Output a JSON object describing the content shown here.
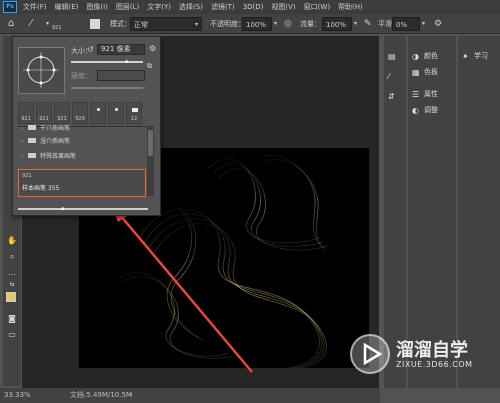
{
  "menu": [
    "文件(F)",
    "编辑(E)",
    "图像(I)",
    "图层(L)",
    "文字(Y)",
    "选择(S)",
    "滤镜(T)",
    "3D(D)",
    "视图(V)",
    "窗口(W)",
    "帮助(H)"
  ],
  "options": {
    "brush_size": "921",
    "mode_label": "模式：",
    "mode_value": "正常",
    "opacity_label": "不透明度：",
    "opacity_value": "100%",
    "flow_label": "流量：",
    "flow_value": "100%",
    "smoothing_label": "平滑：",
    "smoothing_value": "0%"
  },
  "brush_popup": {
    "size_label": "大小：",
    "size_value": "921 像素",
    "hardness_label": "硬度：",
    "presets": [
      "921",
      "921",
      "921",
      "929",
      "",
      "",
      "12"
    ],
    "folders": [
      {
        "label": "干介质画笔"
      },
      {
        "label": "湿介质画笔"
      },
      {
        "label": "特殊效果画笔"
      }
    ],
    "selected": {
      "size": "921",
      "name": "样本画笔 355"
    }
  },
  "status": {
    "zoom": "33.33%",
    "doc": "文档:5.49M/10.5M"
  },
  "panels": {
    "dock2": [
      "颜色",
      "色板",
      "属性",
      "调整"
    ],
    "dock3": [
      "学习"
    ]
  },
  "watermark": {
    "title": "溜溜自学",
    "url": "ZIXUE.3D66.COM"
  },
  "colors": {
    "accent": "#e06b2c",
    "arrow": "#e8483c",
    "foreground_swatch": "#e8c46a"
  }
}
